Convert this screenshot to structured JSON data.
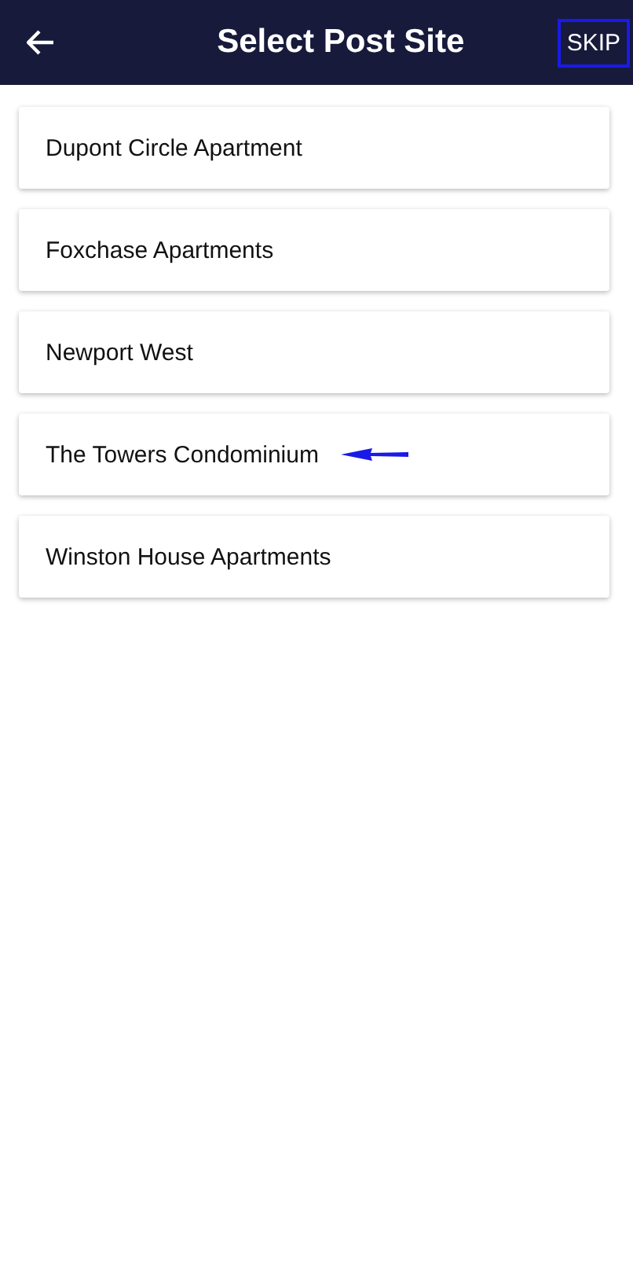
{
  "header": {
    "title": "Select Post Site",
    "skip": {
      "label": "SKIP",
      "highlighted": true
    }
  },
  "sites": [
    {
      "name": "Dupont Circle Apartment",
      "highlighted": false
    },
    {
      "name": "Foxchase Apartments",
      "highlighted": false
    },
    {
      "name": "Newport West",
      "highlighted": false
    },
    {
      "name": "The Towers Condominium",
      "highlighted": true
    },
    {
      "name": "Winston House Apartments",
      "highlighted": false
    }
  ]
}
